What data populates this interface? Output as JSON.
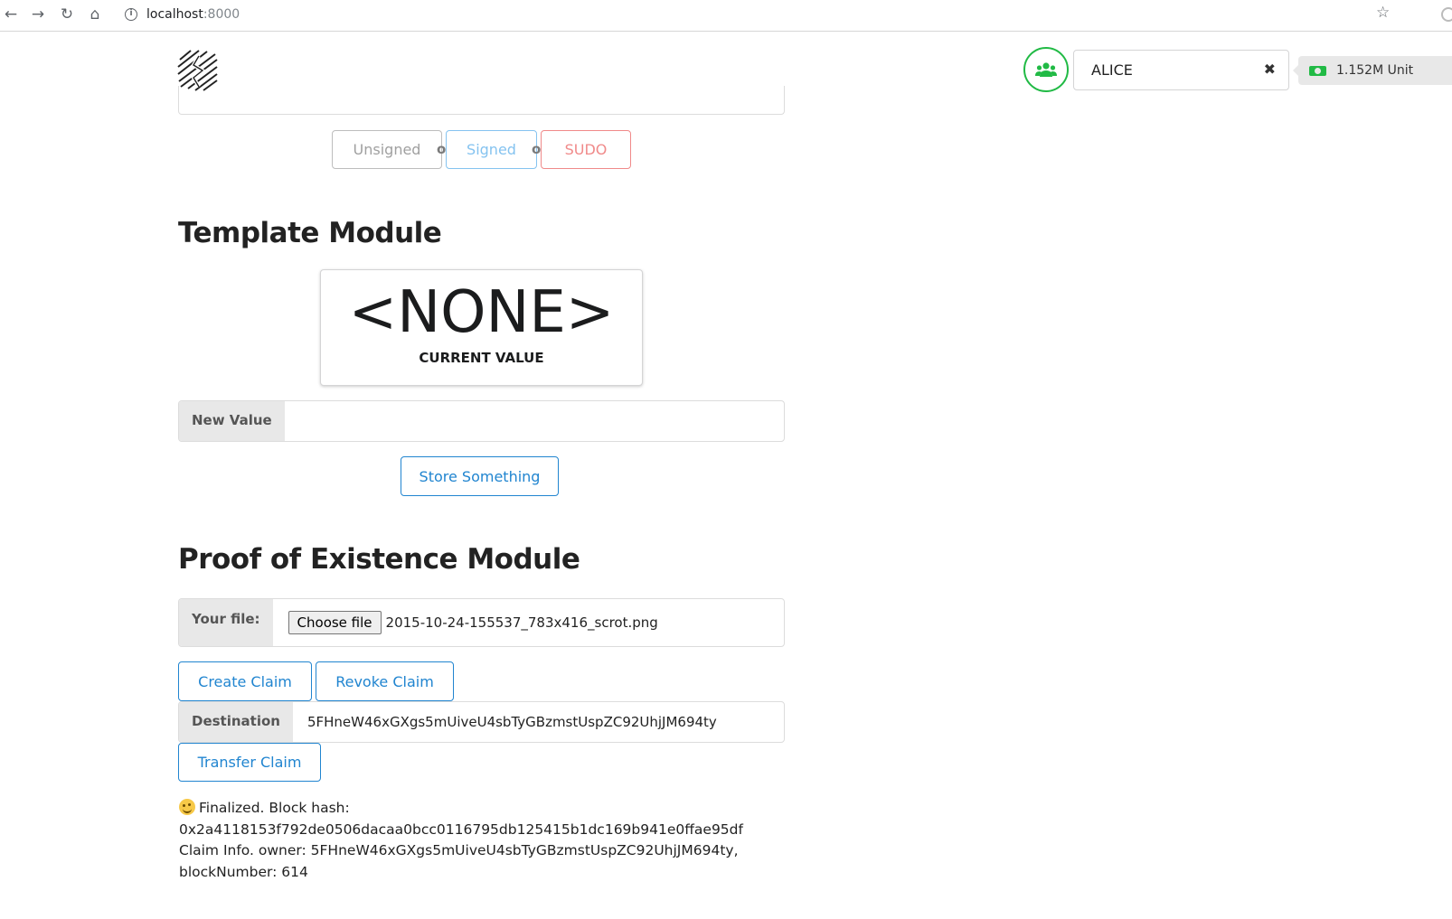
{
  "browser": {
    "url_host": "localhost",
    "url_port": ":8000"
  },
  "header": {
    "account_name": "ALICE",
    "balance": "1.152M Unit",
    "icons": [
      "users-icon",
      "close-icon",
      "money-icon"
    ]
  },
  "tx_buttons": {
    "unsigned": "Unsigned",
    "signed": "Signed",
    "sudo": "SUDO",
    "or": "or",
    "colors": {
      "unsigned": "#a0a0a0",
      "signed": "#85c3f0",
      "sudo": "#f08a8a"
    }
  },
  "template_module": {
    "title": "Template Module",
    "current_value": "<NONE>",
    "current_value_label": "CURRENT VALUE",
    "new_value_label": "New Value",
    "new_value": "",
    "store_button": "Store Something"
  },
  "poe_module": {
    "title": "Proof of Existence Module",
    "file_label": "Your file:",
    "choose_file_button": "Choose file",
    "file_name": "2015-10-24-155537_783x416_scrot.png",
    "create_claim_button": "Create Claim",
    "revoke_claim_button": "Revoke Claim",
    "destination_label": "Destination",
    "destination_value": "5FHneW46xGXgs5mUiveU4sbTyGBzmstUspZC92UhjJM694ty",
    "transfer_claim_button": "Transfer Claim"
  },
  "status": {
    "line1": "Finalized. Block hash:",
    "line2": "0x2a4118153f792de0506dacaa0bcc0116795db125415b1dc169b941e0ffae95df",
    "line3": "Claim Info. owner: 5FHneW46xGXgs5mUiveU4sbTyGBzmstUspZC92UhjJM694ty,",
    "line4": "blockNumber: 614"
  },
  "colors": {
    "accent_blue": "#2185d0",
    "accent_green": "#21ba45"
  }
}
